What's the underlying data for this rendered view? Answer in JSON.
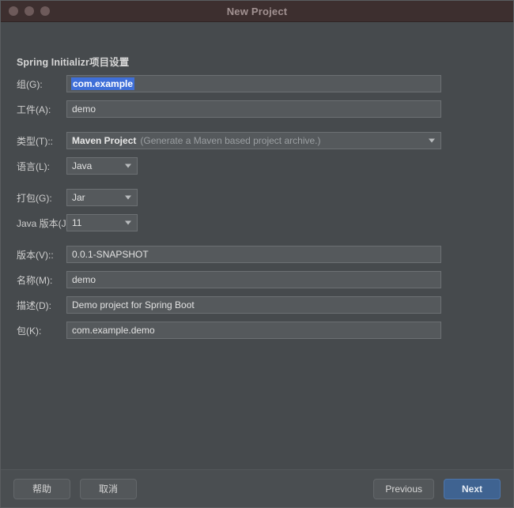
{
  "window": {
    "title": "New Project",
    "traffic_lights": [
      "close-button",
      "minimize-button",
      "zoom-button"
    ]
  },
  "section": {
    "title": "Spring Initializr项目设置"
  },
  "form": {
    "rows": [
      {
        "label": "组(G):",
        "type": "text",
        "value": "com.example",
        "selected": true,
        "width": "wide"
      },
      {
        "label": "工件(A):",
        "type": "text",
        "value": "demo",
        "selected": false,
        "width": "wide"
      },
      {
        "label": "类型(T)::",
        "type": "combo",
        "value": "Maven Project",
        "hint": "(Generate a Maven based project archive.)",
        "width": "wide"
      },
      {
        "label": "语言(L):",
        "type": "combo",
        "value": "Java",
        "width": "small"
      },
      {
        "label": "打包(G):",
        "type": "combo",
        "value": "Jar",
        "width": "small"
      },
      {
        "label": "Java 版本(J):",
        "type": "combo",
        "value": "11",
        "width": "small"
      },
      {
        "label": "版本(V)::",
        "type": "text",
        "value": "0.0.1-SNAPSHOT",
        "width": "wide"
      },
      {
        "label": "名称(M):",
        "type": "text",
        "value": "demo",
        "width": "wide"
      },
      {
        "label": "描述(D):",
        "type": "text",
        "value": "Demo project for Spring Boot",
        "width": "wide"
      },
      {
        "label": "包(K):",
        "type": "text",
        "value": "com.example.demo",
        "width": "wide"
      }
    ]
  },
  "footer": {
    "help_label": "帮助",
    "cancel_label": "取消",
    "previous_label": "Previous",
    "next_label": "Next"
  },
  "colors": {
    "titlebar": "#3d2f2f",
    "dialog_bg": "#464a4d",
    "field_bg": "#55595c",
    "selection_blue": "#3f6fd8",
    "primary_button": "#3f6391"
  }
}
